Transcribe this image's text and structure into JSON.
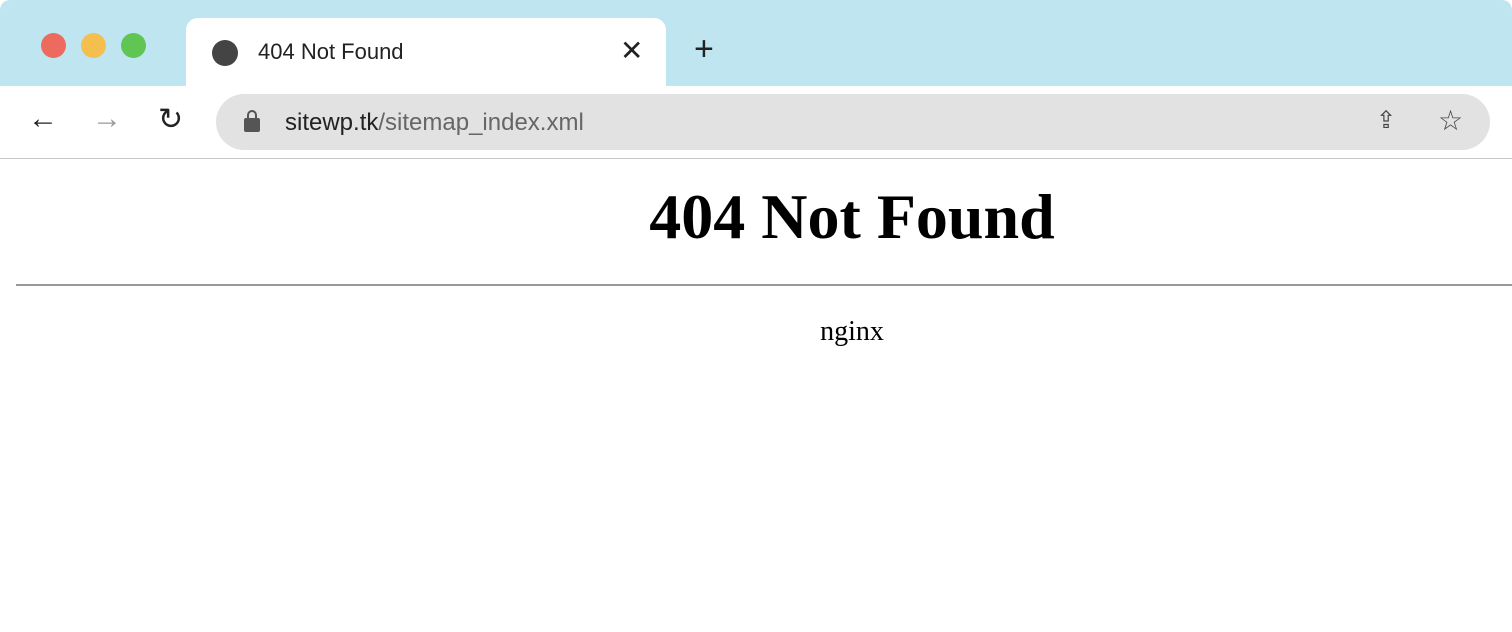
{
  "browser": {
    "tab_title": "404 Not Found",
    "url_host": "sitewp.tk",
    "url_path": "/sitemap_index.xml",
    "traffic_colors": {
      "close": "#ed6a5e",
      "minimize": "#f5bf4f",
      "zoom": "#61c554"
    }
  },
  "page": {
    "heading": "404 Not Found",
    "server": "nginx"
  }
}
